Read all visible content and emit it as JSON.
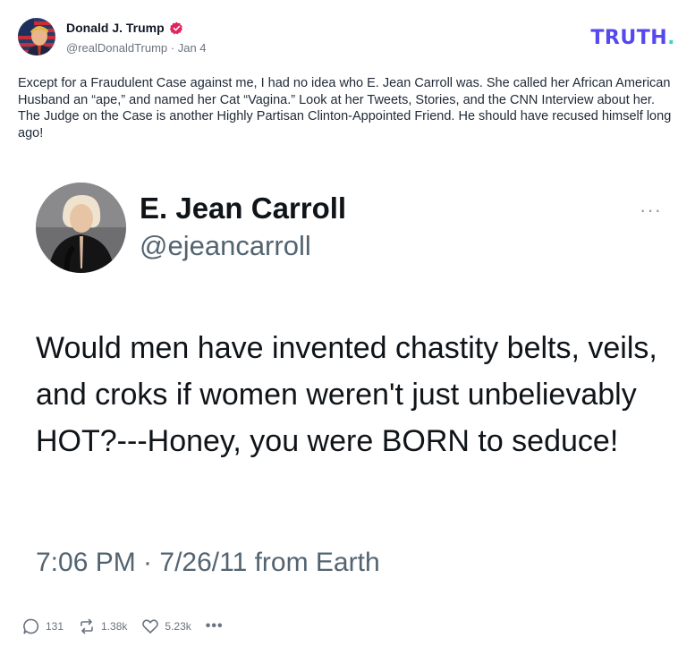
{
  "post": {
    "author_name": "Donald J. Trump",
    "handle": "@realDonaldTrump",
    "separator": " · ",
    "date": "Jan 4",
    "brand": "TRUTH",
    "brand_dot": ".",
    "text": "Except for a Fraudulent Case against me, I had no idea who E. Jean Carroll was. She called her African American Husband an “ape,” and named her Cat “Vagina.” Look at her Tweets, Stories, and the CNN Interview about her. The Judge on the Case is another Highly Partisan Clinton-Appointed Friend. He should have recused himself long ago!"
  },
  "embed": {
    "name": "E. Jean Carroll",
    "handle": "@ejeancarroll",
    "more": "···",
    "body": "Would men have invented chastity belts, veils, and croks if women weren't just unbelievably HOT?---Honey, you were BORN to seduce!",
    "timestamp": "7:06 PM · 7/26/11 from Earth"
  },
  "actions": {
    "replies": "131",
    "retruths": "1.38k",
    "likes": "5.23k",
    "more": "•••"
  },
  "colors": {
    "brand": "#5448ee",
    "brand_dot": "#3dd6c5",
    "verified": "#e0245e",
    "meta": "#6b7280"
  },
  "icons": [
    "flag-avatar",
    "verified-badge-icon",
    "portrait-avatar",
    "reply-icon",
    "retruth-icon",
    "like-icon",
    "more-icon"
  ]
}
